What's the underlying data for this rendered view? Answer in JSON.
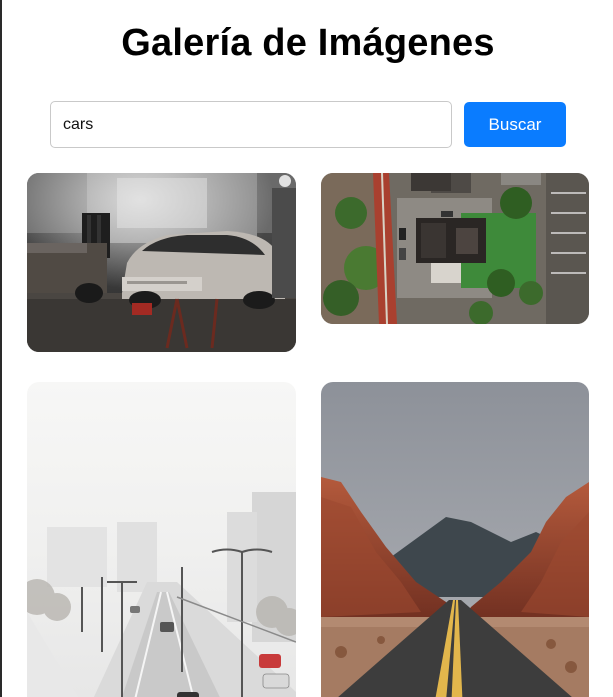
{
  "header": {
    "title": "Galería de Imágenes"
  },
  "search": {
    "value": "cars",
    "button_label": "Buscar"
  },
  "gallery": {
    "images": [
      {
        "subject": "vintage car in workshop garage"
      },
      {
        "subject": "aerial view of house and road"
      },
      {
        "subject": "snowy city highway with street lamps"
      },
      {
        "subject": "desert road between red rock canyons"
      }
    ]
  }
}
